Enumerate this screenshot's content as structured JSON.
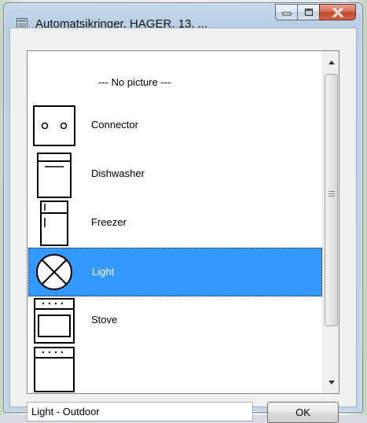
{
  "window": {
    "title": "Automatsikringer, HAGER, 13, ...",
    "icon": "app-window-icon",
    "buttons": {
      "minimize_icon": "minimize-icon",
      "maximize_icon": "maximize-icon",
      "close_icon": "close-icon"
    }
  },
  "list": {
    "items": [
      {
        "label": "--- No picture ---",
        "icon": "none",
        "selected": false
      },
      {
        "label": "Connector",
        "icon": "connector-icon",
        "selected": false
      },
      {
        "label": "Dishwasher",
        "icon": "dishwasher-icon",
        "selected": false
      },
      {
        "label": "Freezer",
        "icon": "freezer-icon",
        "selected": false
      },
      {
        "label": "Light",
        "icon": "light-icon",
        "selected": true
      },
      {
        "label": "Stove",
        "icon": "stove-icon",
        "selected": false
      }
    ]
  },
  "footer": {
    "text_value": "Light - Outdoor",
    "ok_label": "OK"
  },
  "colors": {
    "selection": "#3399ff",
    "close_button": "#c34a30"
  }
}
